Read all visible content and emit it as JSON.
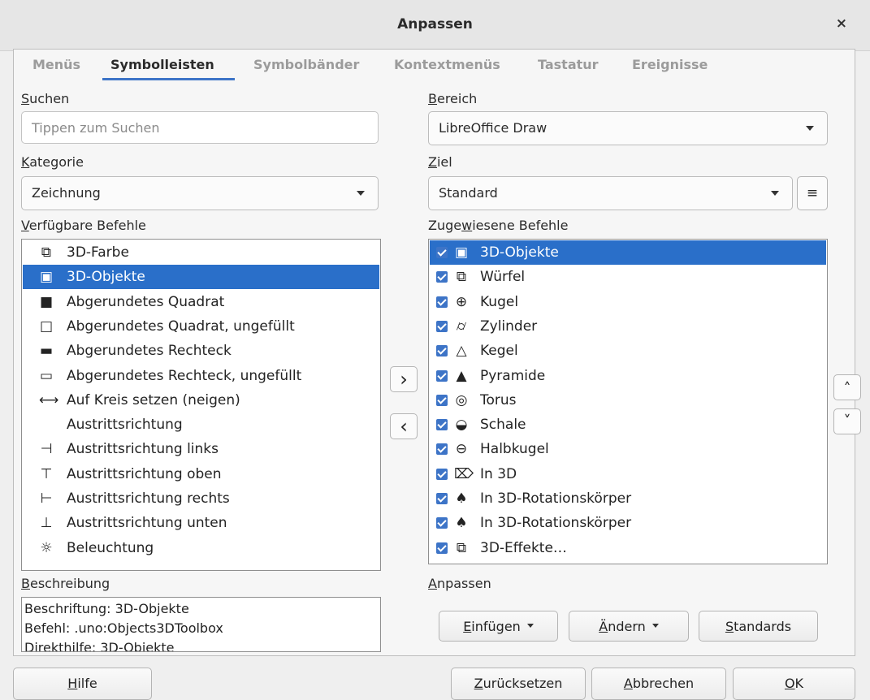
{
  "window": {
    "title": "Anpassen",
    "close_glyph": "×"
  },
  "tabs": [
    {
      "label": "Menüs",
      "active": false
    },
    {
      "label": "Symbolleisten",
      "active": true
    },
    {
      "label": "Symbolbänder",
      "active": false
    },
    {
      "label": "Kontextmenüs",
      "active": false
    },
    {
      "label": "Tastatur",
      "active": false
    },
    {
      "label": "Ereignisse",
      "active": false
    }
  ],
  "left": {
    "search_label_u": "S",
    "search_label_rest": "uchen",
    "search_placeholder": "Tippen zum Suchen",
    "category_label_u": "K",
    "category_label_rest": "ategorie",
    "category_value": "Zeichnung",
    "available_label_u": "V",
    "available_label_rest": "erfügbare Befehle",
    "available_commands": [
      {
        "label": "3D-Farbe",
        "icon": "cube-outline-icon",
        "glyph": "⧉"
      },
      {
        "label": "3D-Objekte",
        "icon": "cube-icon",
        "glyph": "▣",
        "selected": true
      },
      {
        "label": "Abgerundetes Quadrat",
        "icon": "rounded-square-filled-icon",
        "glyph": "■"
      },
      {
        "label": "Abgerundetes Quadrat, ungefüllt",
        "icon": "rounded-square-icon",
        "glyph": "□"
      },
      {
        "label": "Abgerundetes Rechteck",
        "icon": "rounded-rectangle-filled-icon",
        "glyph": "▬"
      },
      {
        "label": "Abgerundetes Rechteck, ungefüllt",
        "icon": "rounded-rectangle-icon",
        "glyph": "▭"
      },
      {
        "label": "Auf Kreis setzen (neigen)",
        "icon": "set-on-circle-icon",
        "glyph": "⟷"
      },
      {
        "label": "Austrittsrichtung",
        "icon": "",
        "glyph": ""
      },
      {
        "label": "Austrittsrichtung links",
        "icon": "exit-left-icon",
        "glyph": "⊣"
      },
      {
        "label": "Austrittsrichtung oben",
        "icon": "exit-top-icon",
        "glyph": "⊤"
      },
      {
        "label": "Austrittsrichtung rechts",
        "icon": "exit-right-icon",
        "glyph": "⊢"
      },
      {
        "label": "Austrittsrichtung unten",
        "icon": "exit-bottom-icon",
        "glyph": "⊥"
      },
      {
        "label": "Beleuchtung",
        "icon": "light-icon",
        "glyph": "☼"
      }
    ],
    "description_label_u": "B",
    "description_label_rest": "eschreibung",
    "description_lines": [
      "Beschriftung: 3D-Objekte",
      "Befehl: .uno:Objects3DToolbox",
      "Direkthilfe: 3D-Objekte"
    ]
  },
  "right": {
    "scope_label_u": "B",
    "scope_label_rest": "ereich",
    "scope_value": "LibreOffice Draw",
    "target_label_u": "Z",
    "target_label_rest": "iel",
    "target_value": "Standard",
    "target_menu_glyph": "≡",
    "assigned_label_pre": "Zuge",
    "assigned_label_u": "w",
    "assigned_label_rest": "iesene Befehle",
    "assigned_commands": [
      {
        "label": "3D-Objekte",
        "icon": "cube-icon",
        "glyph": "▣",
        "selected": true
      },
      {
        "label": "Würfel",
        "icon": "cube-icon",
        "glyph": "⧉"
      },
      {
        "label": "Kugel",
        "icon": "sphere-icon",
        "glyph": "⊕"
      },
      {
        "label": "Zylinder",
        "icon": "cylinder-icon",
        "glyph": "⌭"
      },
      {
        "label": "Kegel",
        "icon": "cone-icon",
        "glyph": "△"
      },
      {
        "label": "Pyramide",
        "icon": "pyramid-icon",
        "glyph": "▲"
      },
      {
        "label": "Torus",
        "icon": "torus-icon",
        "glyph": "◎"
      },
      {
        "label": "Schale",
        "icon": "shell-icon",
        "glyph": "◒"
      },
      {
        "label": "Halbkugel",
        "icon": "half-sphere-icon",
        "glyph": "⊖"
      },
      {
        "label": "In 3D",
        "icon": "to-3d-icon",
        "glyph": "⌦"
      },
      {
        "label": "In 3D-Rotationskörper",
        "icon": "rotation-body-icon",
        "glyph": "♠"
      },
      {
        "label": "In 3D-Rotationskörper",
        "icon": "rotation-body-icon",
        "glyph": "♠"
      },
      {
        "label": "3D-Effekte…",
        "icon": "3d-effects-icon",
        "glyph": "⧉"
      }
    ],
    "customize_label_u": "A",
    "customize_label_rest": "npassen",
    "insert_u": "E",
    "insert_rest": "infügen",
    "modify_u": "Ä",
    "modify_rest": "ndern",
    "defaults_u": "S",
    "defaults_rest": "tandards"
  },
  "transfer": {
    "add_glyph": "›",
    "remove_glyph": "‹",
    "up_glyph": "˄",
    "down_glyph": "˅"
  },
  "footer": {
    "help_u": "H",
    "help_rest": "ilfe",
    "reset_u": "Z",
    "reset_rest": "urücksetzen",
    "cancel_u": "A",
    "cancel_rest": "bbrechen",
    "ok_u": "O",
    "ok_rest": "K"
  }
}
